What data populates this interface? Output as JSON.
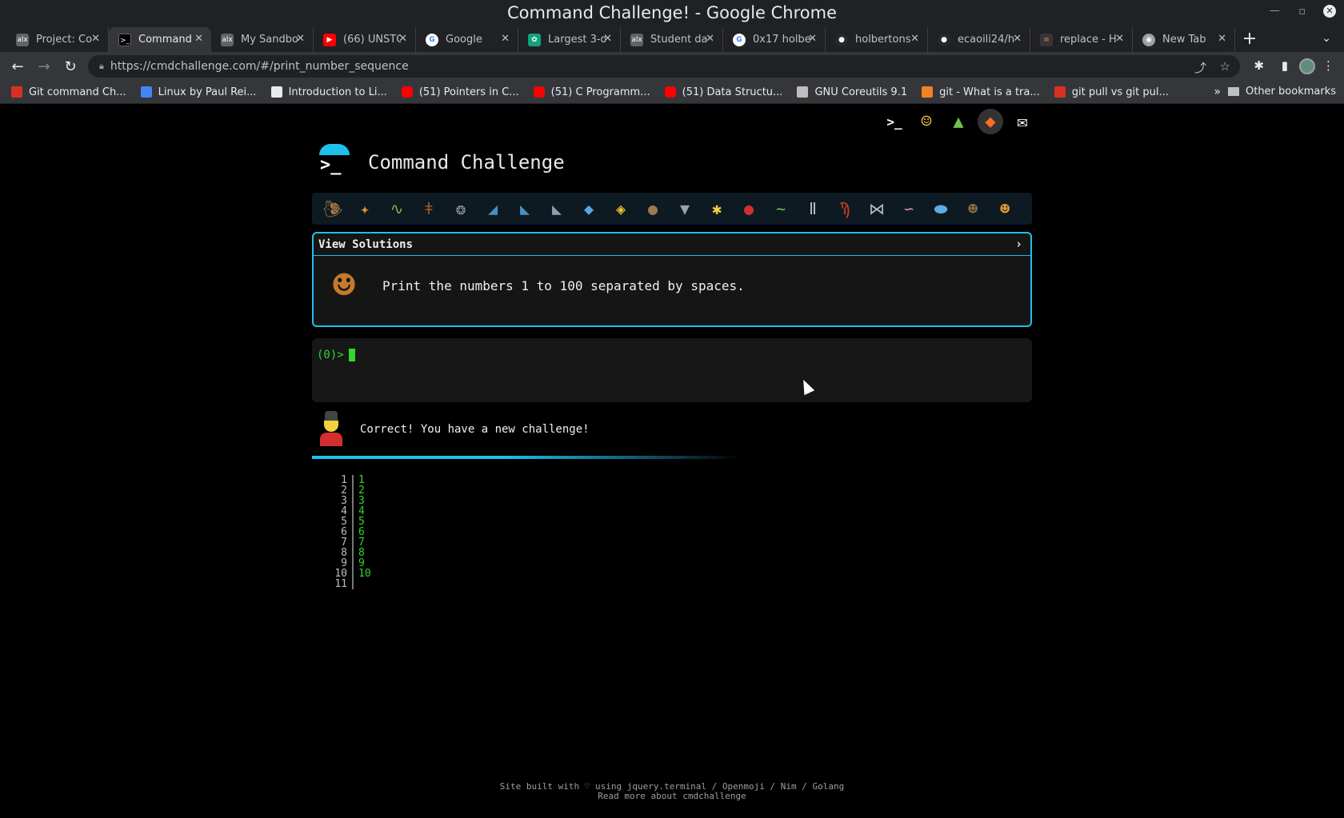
{
  "window": {
    "title": "Command Challenge! - Google Chrome"
  },
  "tabs": [
    {
      "label": "Project: Co",
      "icon": "alx-icon",
      "color": "#5f6368"
    },
    {
      "label": "Command",
      "icon": "terminal-icon",
      "color": "#000000",
      "active": true
    },
    {
      "label": "My Sandbo",
      "icon": "alx-icon",
      "color": "#5f6368"
    },
    {
      "label": "(66) UNSTO",
      "icon": "youtube-icon",
      "color": "#ff0000"
    },
    {
      "label": "Google",
      "icon": "google-icon",
      "color": "#4285f4"
    },
    {
      "label": "Largest 3-d",
      "icon": "chatgpt-icon",
      "color": "#10a37f"
    },
    {
      "label": "Student da",
      "icon": "alx-icon",
      "color": "#5f6368"
    },
    {
      "label": "0x17 holbe",
      "icon": "google-icon",
      "color": "#4285f4"
    },
    {
      "label": "holbertons",
      "icon": "github-icon",
      "color": "#24292e"
    },
    {
      "label": "ecaoili24/h",
      "icon": "github-icon",
      "color": "#24292e"
    },
    {
      "label": "replace - H",
      "icon": "stackoverflow-icon",
      "color": "#f48024"
    },
    {
      "label": "New Tab",
      "icon": "chrome-icon",
      "color": "#9aa0a6"
    }
  ],
  "toolbar": {
    "url": "https://cmdchallenge.com/#/print_number_sequence"
  },
  "bookmarks": [
    {
      "label": "Git command Ch...",
      "icon": "bird-icon",
      "color": "#d93025"
    },
    {
      "label": "Linux by Paul Rei...",
      "icon": "grid-icon",
      "color": "#4285f4"
    },
    {
      "label": "Introduction to Li...",
      "icon": "page-icon",
      "color": "#e8eaed"
    },
    {
      "label": "(51) Pointers in C...",
      "icon": "youtube-icon",
      "color": "#ff0000"
    },
    {
      "label": "(51) C Programm...",
      "icon": "youtube-icon",
      "color": "#ff0000"
    },
    {
      "label": "(51) Data Structu...",
      "icon": "youtube-icon",
      "color": "#ff0000"
    },
    {
      "label": "GNU Coreutils 9.1",
      "icon": "gnu-icon",
      "color": "#bdbdbd"
    },
    {
      "label": "git - What is a tra...",
      "icon": "stackoverflow-icon",
      "color": "#f48024"
    },
    {
      "label": "git pull vs git pul...",
      "icon": "bird-icon",
      "color": "#d93025"
    }
  ],
  "other_bookmarks": "Other bookmarks",
  "site": {
    "title": "Command Challenge",
    "view_solutions": "View Solutions",
    "challenge_text": "Print the numbers 1 to 100 separated by spaces.",
    "prompt": "(0)>",
    "feedback": "Correct! You have a new challenge!",
    "progress": 0.45,
    "output_line_numbers": [
      "1",
      "2",
      "3",
      "4",
      "5",
      "6",
      "7",
      "8",
      "9",
      "10",
      "11"
    ],
    "output_lines": [
      "1",
      "2",
      "3",
      "4",
      "5",
      "6",
      "7",
      "8",
      "9",
      "10",
      ""
    ],
    "footer_line1": "Site built with ♡ using jquery.terminal / Openmoji / Nim / Golang",
    "footer_line2": "Read more about cmdchallenge"
  },
  "animals": [
    "snail",
    "butterfly",
    "caterpillar",
    "ant",
    "spider-web",
    "shark",
    "dolphin",
    "dolphin",
    "fish",
    "tropical-fish",
    "blowfish",
    "wolf",
    "bee",
    "ladybug",
    "lizard",
    "mosquito",
    "scorpion",
    "fly",
    "worm",
    "microbe",
    "monkey",
    "dog"
  ]
}
